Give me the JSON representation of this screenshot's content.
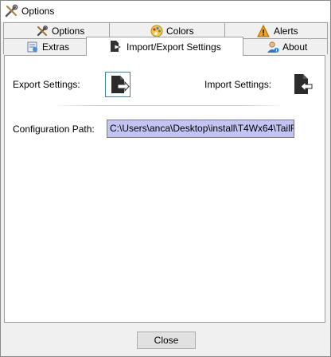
{
  "window": {
    "title": "Options",
    "title_icon": "tools-icon"
  },
  "tabs": {
    "row_top": [
      {
        "label": "Options",
        "icon": "tools-icon"
      },
      {
        "label": "Colors",
        "icon": "palette-icon"
      },
      {
        "label": "Alerts",
        "icon": "warning-icon"
      }
    ],
    "row_bottom": [
      {
        "label": "Extras",
        "icon": "extras-icon"
      },
      {
        "label": "Import/Export Settings",
        "icon": "import-export-icon",
        "active": true
      },
      {
        "label": "About",
        "icon": "user-info-icon"
      }
    ]
  },
  "panel": {
    "export_label": "Export Settings:",
    "export_icon": "export-document-icon",
    "import_label": "Import Settings:",
    "import_icon": "import-document-icon",
    "config_label": "Configuration Path:",
    "config_path": "C:\\Users\\anca\\Desktop\\install\\T4Wx64\\TailForWi",
    "config_field_color": "#c4c4f4"
  },
  "footer": {
    "close_label": "Close"
  },
  "colors": {
    "accent_border": "#3c7fb1",
    "window_bg": "#f0f0f0"
  }
}
